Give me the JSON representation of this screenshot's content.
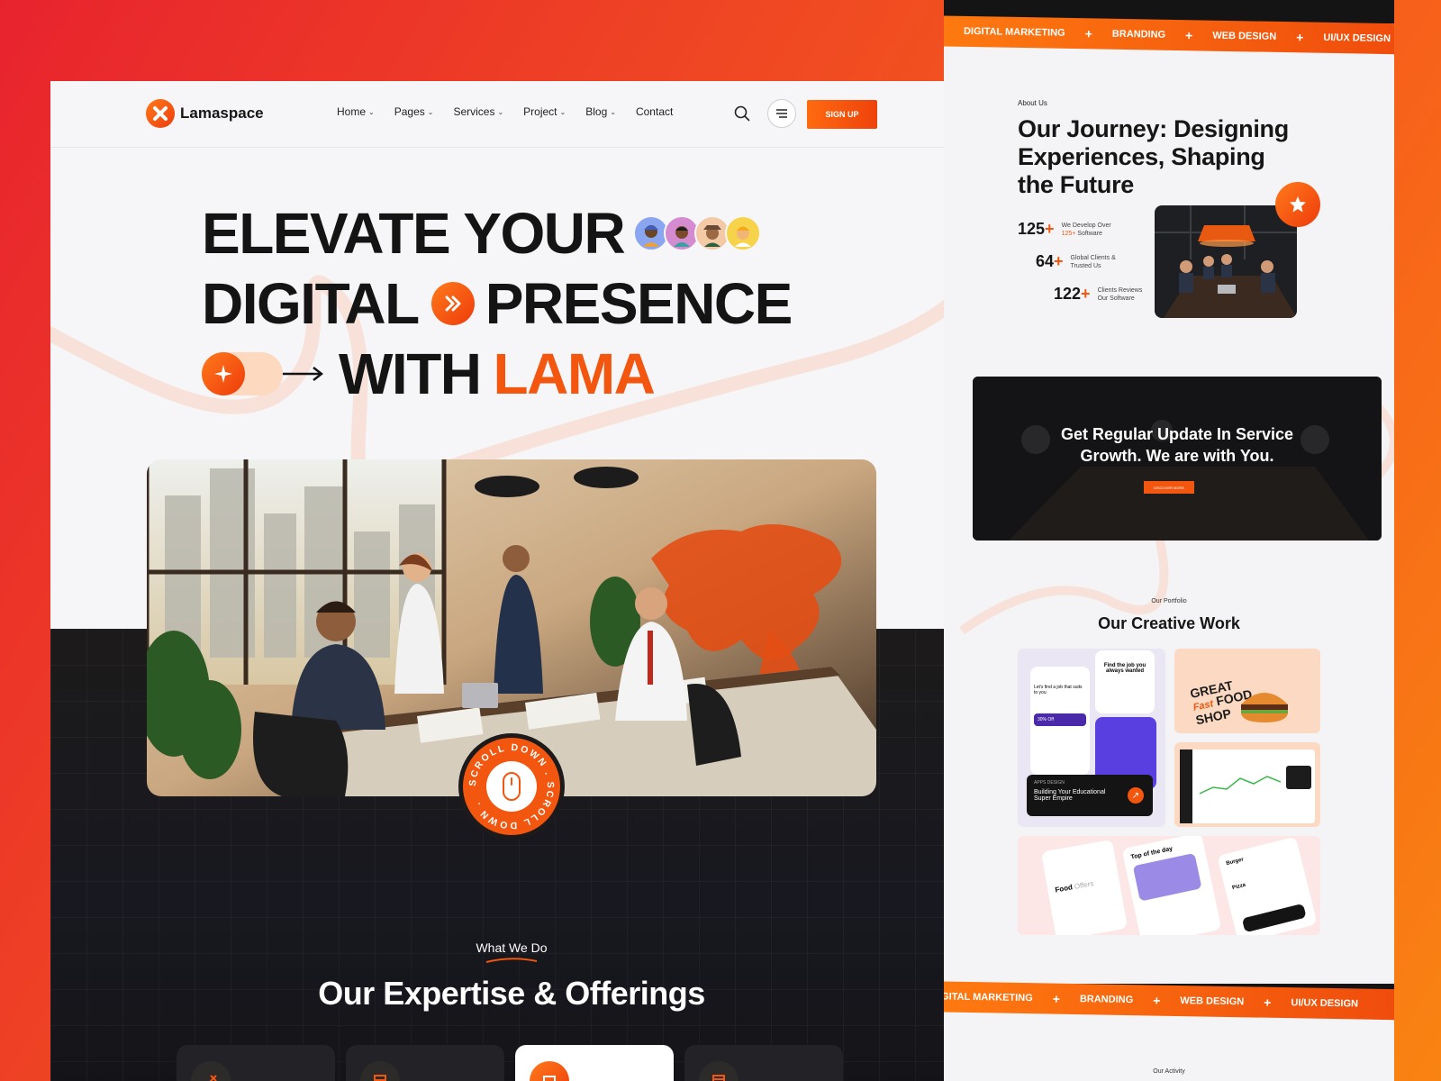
{
  "brand": {
    "name": "Lamaspace"
  },
  "nav": {
    "items": [
      {
        "label": "Home",
        "dropdown": true
      },
      {
        "label": "Pages",
        "dropdown": true
      },
      {
        "label": "Services",
        "dropdown": true
      },
      {
        "label": "Project",
        "dropdown": true
      },
      {
        "label": "Blog",
        "dropdown": true
      },
      {
        "label": "Contact",
        "dropdown": false
      }
    ],
    "search_icon": "search-icon",
    "menu_icon": "hamburger-icon",
    "signup_label": "SIGN UP"
  },
  "hero": {
    "line1": "ELEVATE YOUR",
    "line2a": "DIGITAL",
    "line2b": "PRESENCE",
    "line3a": "WITH",
    "line3b": "LAMA"
  },
  "scroll_badge": {
    "text": "SCROLL DOWN . SCROLL DOWN . "
  },
  "services": {
    "tag": "What We Do",
    "title": "Our Expertise & Offerings"
  },
  "ticker": {
    "items": [
      "DIGITAL MARKETING",
      "BRANDING",
      "WEB DESIGN",
      "UI/UX DESIGN"
    ],
    "items_bottom": [
      "IGITAL MARKETING",
      "BRANDING",
      "WEB DESIGN",
      "UI/UX DESIGN"
    ]
  },
  "about": {
    "tag": "About Us",
    "title": "Our Journey: Designing Experiences, Shaping the Future",
    "stats": [
      {
        "num": "125",
        "suffix": "+",
        "label_a": "We Develop Over",
        "label_hi": "125+",
        "label_b": "Software"
      },
      {
        "num": "64",
        "suffix": "+",
        "label_a": "Global Clients &",
        "label_b": "Trusted Us"
      },
      {
        "num": "122",
        "suffix": "+",
        "label_a": "Clients Reviews",
        "label_b": "Our Software"
      }
    ]
  },
  "cta": {
    "line1": "Get Regular Update In Service",
    "line2": "Growth. We are with You.",
    "button": "DISCOVER MORE"
  },
  "portfolio": {
    "tag": "Our Portfolio",
    "title": "Our Creative Work",
    "card1": {
      "tag": "APPS DESIGN",
      "line1": "Building Your Educational",
      "line2": "Super Empire"
    },
    "app_text": {
      "a": "Find the job you always wanted",
      "b": "Let's find a job that suits to you",
      "c": "30% Off"
    },
    "food_text": {
      "a": "GREAT",
      "b": "Fast",
      "c": "FOOD",
      "d": "SHOP"
    },
    "food_app": {
      "a": "Food",
      "b": "Offers",
      "c": "Top of the day",
      "d": "Burger",
      "e": "Pizza"
    }
  },
  "activity": {
    "tag": "Our Activity"
  },
  "colors": {
    "accent": "#f2560f",
    "dark": "#1c1a1a",
    "bg": "#f6f6f9"
  }
}
